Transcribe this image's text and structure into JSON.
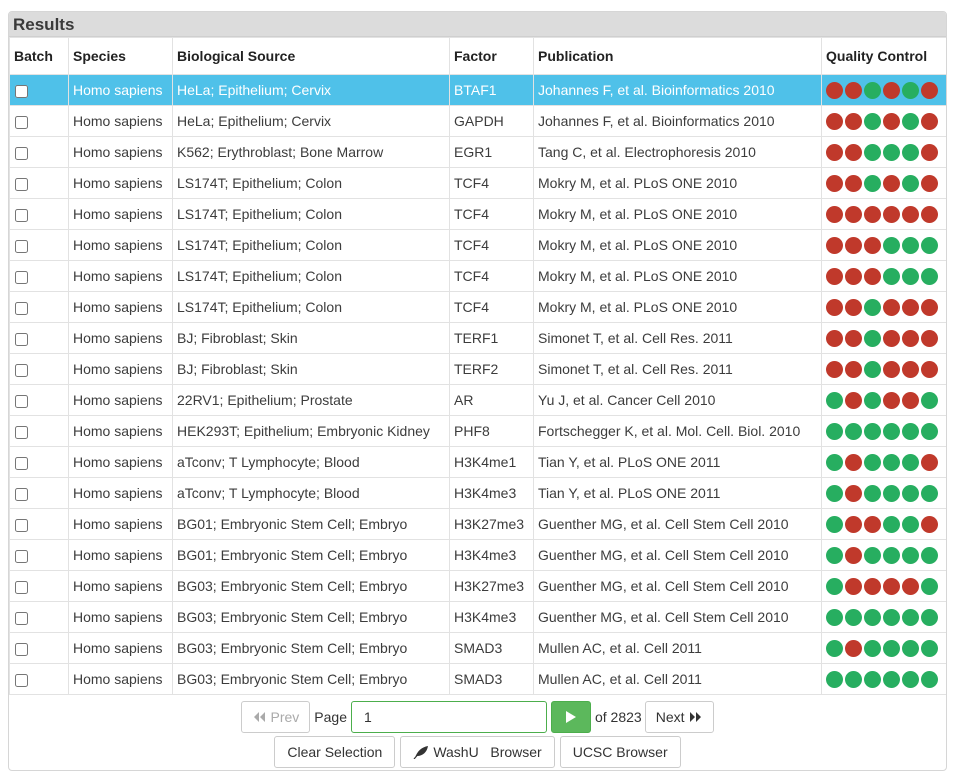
{
  "panel": {
    "title": "Results"
  },
  "table": {
    "columns": [
      "Batch",
      "Species",
      "Biological Source",
      "Factor",
      "Publication",
      "Quality Control"
    ],
    "rows": [
      {
        "species": "Homo sapiens",
        "source": "HeLa; Epithelium; Cervix",
        "factor": "BTAF1",
        "publication": "Johannes F, et al. Bioinformatics 2010",
        "qc": [
          "red",
          "red",
          "green",
          "red",
          "green",
          "red"
        ],
        "selected": true
      },
      {
        "species": "Homo sapiens",
        "source": "HeLa; Epithelium; Cervix",
        "factor": "GAPDH",
        "publication": "Johannes F, et al. Bioinformatics 2010",
        "qc": [
          "red",
          "red",
          "green",
          "red",
          "green",
          "red"
        ],
        "selected": false
      },
      {
        "species": "Homo sapiens",
        "source": "K562; Erythroblast; Bone Marrow",
        "factor": "EGR1",
        "publication": "Tang C, et al. Electrophoresis 2010",
        "qc": [
          "red",
          "red",
          "green",
          "green",
          "green",
          "red"
        ],
        "selected": false
      },
      {
        "species": "Homo sapiens",
        "source": "LS174T; Epithelium; Colon",
        "factor": "TCF4",
        "publication": "Mokry M, et al. PLoS ONE 2010",
        "qc": [
          "red",
          "red",
          "green",
          "red",
          "green",
          "red"
        ],
        "selected": false
      },
      {
        "species": "Homo sapiens",
        "source": "LS174T; Epithelium; Colon",
        "factor": "TCF4",
        "publication": "Mokry M, et al. PLoS ONE 2010",
        "qc": [
          "red",
          "red",
          "red",
          "red",
          "red",
          "red"
        ],
        "selected": false
      },
      {
        "species": "Homo sapiens",
        "source": "LS174T; Epithelium; Colon",
        "factor": "TCF4",
        "publication": "Mokry M, et al. PLoS ONE 2010",
        "qc": [
          "red",
          "red",
          "red",
          "green",
          "green",
          "green"
        ],
        "selected": false
      },
      {
        "species": "Homo sapiens",
        "source": "LS174T; Epithelium; Colon",
        "factor": "TCF4",
        "publication": "Mokry M, et al. PLoS ONE 2010",
        "qc": [
          "red",
          "red",
          "red",
          "green",
          "green",
          "green"
        ],
        "selected": false
      },
      {
        "species": "Homo sapiens",
        "source": "LS174T; Epithelium; Colon",
        "factor": "TCF4",
        "publication": "Mokry M, et al. PLoS ONE 2010",
        "qc": [
          "red",
          "red",
          "green",
          "red",
          "red",
          "red"
        ],
        "selected": false
      },
      {
        "species": "Homo sapiens",
        "source": "BJ; Fibroblast; Skin",
        "factor": "TERF1",
        "publication": "Simonet T, et al. Cell Res. 2011",
        "qc": [
          "red",
          "red",
          "green",
          "red",
          "red",
          "red"
        ],
        "selected": false
      },
      {
        "species": "Homo sapiens",
        "source": "BJ; Fibroblast; Skin",
        "factor": "TERF2",
        "publication": "Simonet T, et al. Cell Res. 2011",
        "qc": [
          "red",
          "red",
          "green",
          "red",
          "red",
          "red"
        ],
        "selected": false
      },
      {
        "species": "Homo sapiens",
        "source": "22RV1; Epithelium; Prostate",
        "factor": "AR",
        "publication": "Yu J, et al. Cancer Cell 2010",
        "qc": [
          "green",
          "red",
          "green",
          "red",
          "red",
          "green"
        ],
        "selected": false
      },
      {
        "species": "Homo sapiens",
        "source": "HEK293T; Epithelium; Embryonic Kidney",
        "factor": "PHF8",
        "publication": "Fortschegger K, et al. Mol. Cell. Biol. 2010",
        "qc": [
          "green",
          "green",
          "green",
          "green",
          "green",
          "green"
        ],
        "selected": false
      },
      {
        "species": "Homo sapiens",
        "source": "aTconv; T Lymphocyte; Blood",
        "factor": "H3K4me1",
        "publication": "Tian Y, et al. PLoS ONE 2011",
        "qc": [
          "green",
          "red",
          "green",
          "green",
          "green",
          "red"
        ],
        "selected": false
      },
      {
        "species": "Homo sapiens",
        "source": "aTconv; T Lymphocyte; Blood",
        "factor": "H3K4me3",
        "publication": "Tian Y, et al. PLoS ONE 2011",
        "qc": [
          "green",
          "red",
          "green",
          "green",
          "green",
          "green"
        ],
        "selected": false
      },
      {
        "species": "Homo sapiens",
        "source": "BG01; Embryonic Stem Cell; Embryo",
        "factor": "H3K27me3",
        "publication": "Guenther MG, et al. Cell Stem Cell 2010",
        "qc": [
          "green",
          "red",
          "red",
          "green",
          "green",
          "red"
        ],
        "selected": false
      },
      {
        "species": "Homo sapiens",
        "source": "BG01; Embryonic Stem Cell; Embryo",
        "factor": "H3K4me3",
        "publication": "Guenther MG, et al. Cell Stem Cell 2010",
        "qc": [
          "green",
          "red",
          "green",
          "green",
          "green",
          "green"
        ],
        "selected": false
      },
      {
        "species": "Homo sapiens",
        "source": "BG03; Embryonic Stem Cell; Embryo",
        "factor": "H3K27me3",
        "publication": "Guenther MG, et al. Cell Stem Cell 2010",
        "qc": [
          "green",
          "red",
          "red",
          "red",
          "red",
          "green"
        ],
        "selected": false
      },
      {
        "species": "Homo sapiens",
        "source": "BG03; Embryonic Stem Cell; Embryo",
        "factor": "H3K4me3",
        "publication": "Guenther MG, et al. Cell Stem Cell 2010",
        "qc": [
          "green",
          "green",
          "green",
          "green",
          "green",
          "green"
        ],
        "selected": false
      },
      {
        "species": "Homo sapiens",
        "source": "BG03; Embryonic Stem Cell; Embryo",
        "factor": "SMAD3",
        "publication": "Mullen AC, et al. Cell 2011",
        "qc": [
          "green",
          "red",
          "green",
          "green",
          "green",
          "green"
        ],
        "selected": false
      },
      {
        "species": "Homo sapiens",
        "source": "BG03; Embryonic Stem Cell; Embryo",
        "factor": "SMAD3",
        "publication": "Mullen AC, et al. Cell 2011",
        "qc": [
          "green",
          "green",
          "green",
          "green",
          "green",
          "green"
        ],
        "selected": false
      }
    ]
  },
  "pager": {
    "prev_label": "Prev",
    "page_label": "Page",
    "page_value": "1",
    "of_label": "of 2823",
    "next_label": "Next",
    "prev_icon": "double-chevron-left-icon",
    "next_icon": "double-chevron-right-icon",
    "go_icon": "play-icon"
  },
  "actions": {
    "clear_label": "Clear Selection",
    "washu_label": "WashU   Browser",
    "ucsc_label": "UCSC Browser",
    "washu_icon": "leaf-icon"
  },
  "colors": {
    "selected_row": "#4fc1e9",
    "qc_red": "#c0392b",
    "qc_green": "#27ae60",
    "go_button": "#5cb85c"
  }
}
